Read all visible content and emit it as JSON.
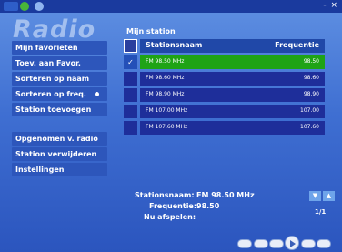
{
  "app": {
    "brand": "Radio"
  },
  "titlebar": {
    "controls": "- ×"
  },
  "sidebar": {
    "group1": [
      {
        "label": "Mijn favorieten"
      },
      {
        "label": "Toev. aan Favor."
      },
      {
        "label": "Sorteren op naam"
      },
      {
        "label": "Sorteren op freq."
      },
      {
        "label": "Station toevoegen"
      }
    ],
    "group2": [
      {
        "label": "Opgenomen v. radio"
      },
      {
        "label": "Station verwijderen"
      },
      {
        "label": "Instellingen"
      }
    ]
  },
  "main": {
    "title": "Mijn station",
    "table": {
      "col_name": "Stationsnaam",
      "col_freq": "Frequentie",
      "rows": [
        {
          "name": "FM 98.50 MHz",
          "freq": "98.50",
          "checked": "✓"
        },
        {
          "name": "FM 98.60 MHz",
          "freq": "98.60"
        },
        {
          "name": "FM 98.90 MHz",
          "freq": "98.90"
        },
        {
          "name": "FM 107.00 MHz",
          "freq": "107.00"
        },
        {
          "name": "FM 107.60 MHz",
          "freq": "107.60"
        }
      ]
    },
    "info": {
      "name_label": "Stationsnaam:",
      "name_value": "FM 98.50 MHz",
      "freq_label": "Frequentie:",
      "freq_value": "98.50",
      "playing_label": "Nu afspelen:",
      "playing_value": ""
    },
    "pager": {
      "indicator": "1/1"
    }
  },
  "colors": {
    "selected_row": "#1fa315",
    "row": "#1e2e9a",
    "background": "#3f6fd2"
  }
}
